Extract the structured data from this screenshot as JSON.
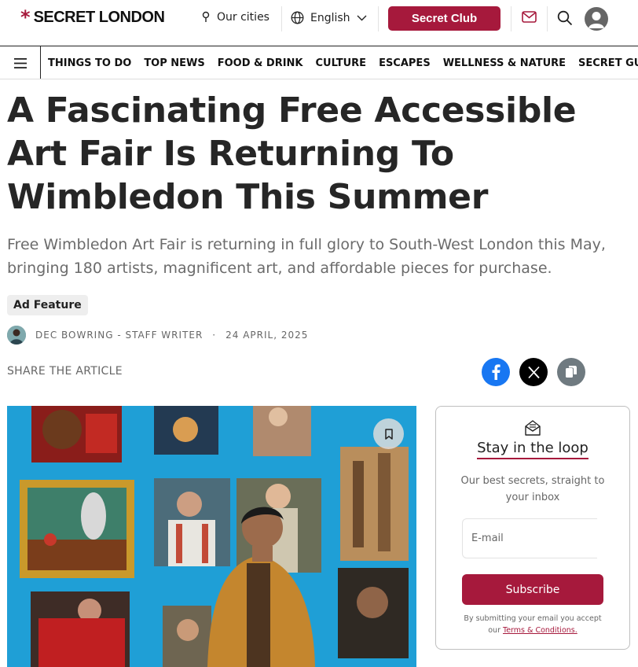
{
  "header": {
    "logo_star": "*",
    "logo_text": "SECRET LONDON",
    "cities_label": "Our cities",
    "language_label": "English",
    "club_button": "Secret Club"
  },
  "nav": {
    "items": [
      "THINGS TO DO",
      "TOP NEWS",
      "FOOD & DRINK",
      "CULTURE",
      "ESCAPES",
      "WELLNESS & NATURE",
      "SECRET GUIDES"
    ]
  },
  "article": {
    "headline": "A Fascinating Free Accessible Art Fair Is Returning To Wimbledon This Summer",
    "subtitle": "Free Wimbledon Art Fair is returning in full glory to South-West London this May, bringing 180 artists, magnificent art, and affordable pieces for purchase.",
    "badge": "Ad Feature",
    "author": "DEC BOWRING - STAFF WRITER",
    "separator": "·",
    "date": "24 APRIL, 2025",
    "share_label": "SHARE THE ARTICLE"
  },
  "newsletter": {
    "title": "Stay in the loop",
    "description": "Our best secrets, straight to your inbox",
    "email_placeholder": "E-mail",
    "subscribe_label": "Subscribe",
    "legal_prefix": "By submitting your email you accept our",
    "legal_link": "Terms & Conditions."
  },
  "colors": {
    "brand": "#a6193c",
    "facebook": "#1877f2",
    "x": "#000000",
    "copy": "#6f7a80",
    "hero_wall": "#1f9fd6"
  },
  "icons": {
    "location": "location-pin-icon",
    "language": "globe-icon",
    "mail": "mail-icon",
    "search": "search-icon",
    "user": "user-avatar-icon",
    "menu": "hamburger-menu-icon",
    "bookmark": "bookmark-icon"
  }
}
